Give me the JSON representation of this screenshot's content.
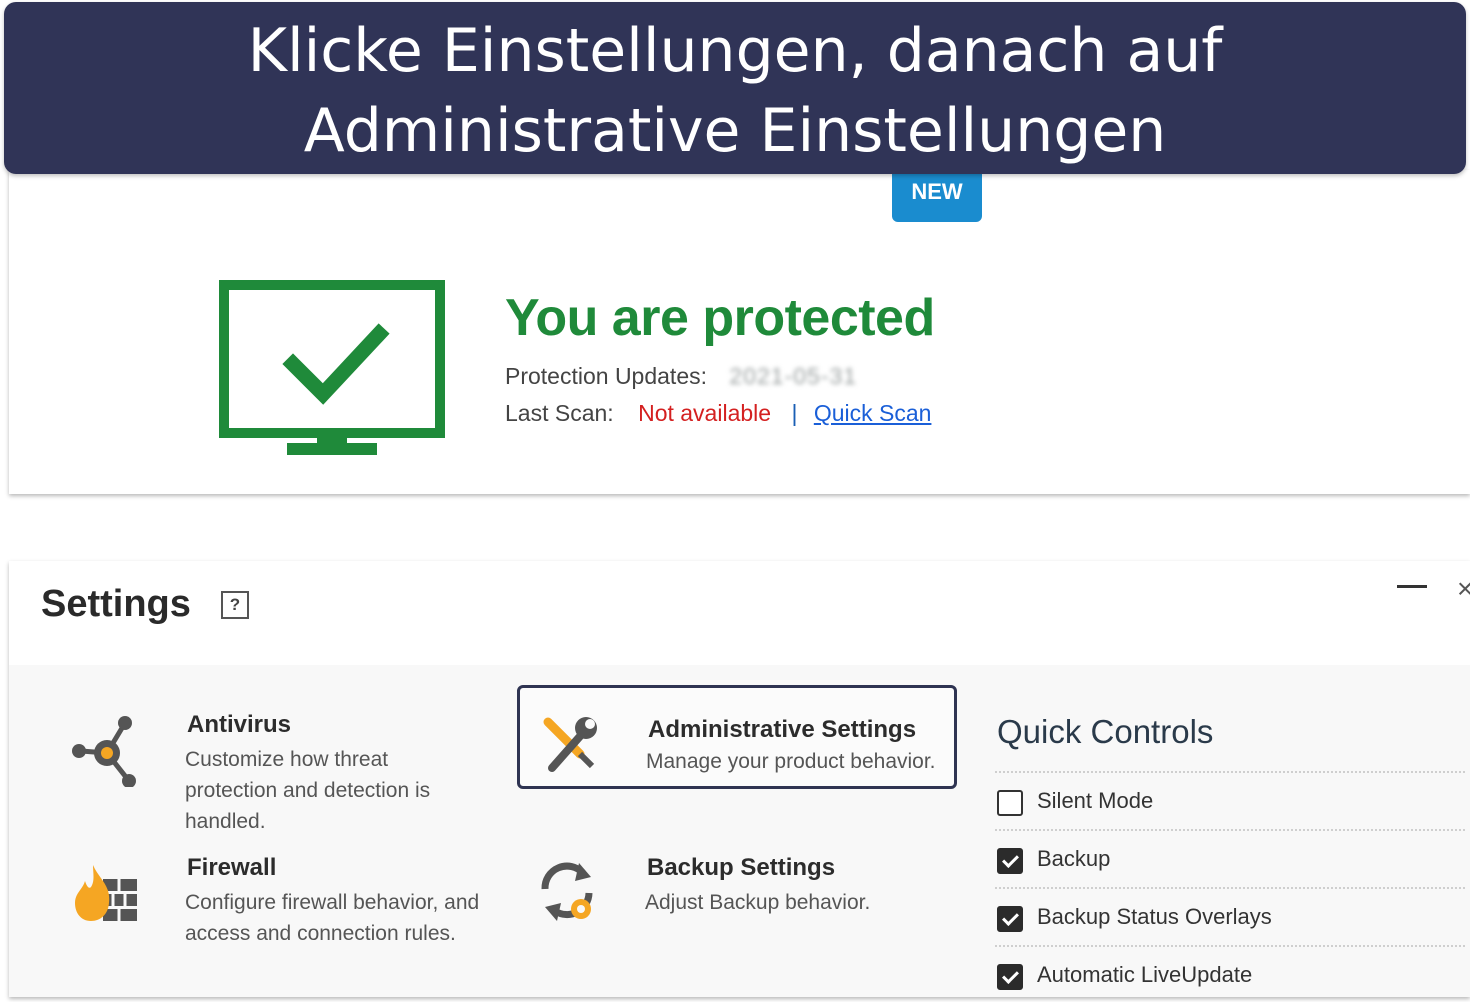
{
  "banner": {
    "line1": "Klicke Einstellungen, danach auf",
    "line2": "Administrative Einstellungen"
  },
  "status": {
    "badge": "NEW",
    "title": "You are protected",
    "updates_label": "Protection Updates:",
    "updates_value": "2021-05-31",
    "last_scan_label": "Last Scan:",
    "last_scan_value": "Not available",
    "separator": "|",
    "quick_scan_link": "Quick Scan",
    "monitor_icon": "monitor-check-icon",
    "colors": {
      "protected_green": "#1f8a3a",
      "warning_red": "#d42020",
      "badge_blue": "#1a8ccf"
    }
  },
  "settings": {
    "title": "Settings",
    "help": "?",
    "tiles": [
      {
        "icon": "antivirus-nodes-icon",
        "title": "Antivirus",
        "desc": "Customize how threat protection and detection is handled."
      },
      {
        "icon": "wrench-screwdriver-icon",
        "title": "Administrative Settings",
        "desc": "Manage your product behavior."
      },
      {
        "icon": "firewall-flame-icon",
        "title": "Firewall",
        "desc": "Configure firewall behavior, and access and connection rules."
      },
      {
        "icon": "backup-sync-icon",
        "title": "Backup Settings",
        "desc": "Adjust Backup behavior."
      }
    ],
    "quick_controls": {
      "title": "Quick Controls",
      "items": [
        {
          "label": "Silent Mode",
          "checked": false
        },
        {
          "label": "Backup",
          "checked": true
        },
        {
          "label": "Backup Status Overlays",
          "checked": true
        },
        {
          "label": "Automatic LiveUpdate",
          "checked": true
        }
      ]
    }
  },
  "banner_color": "#303457"
}
